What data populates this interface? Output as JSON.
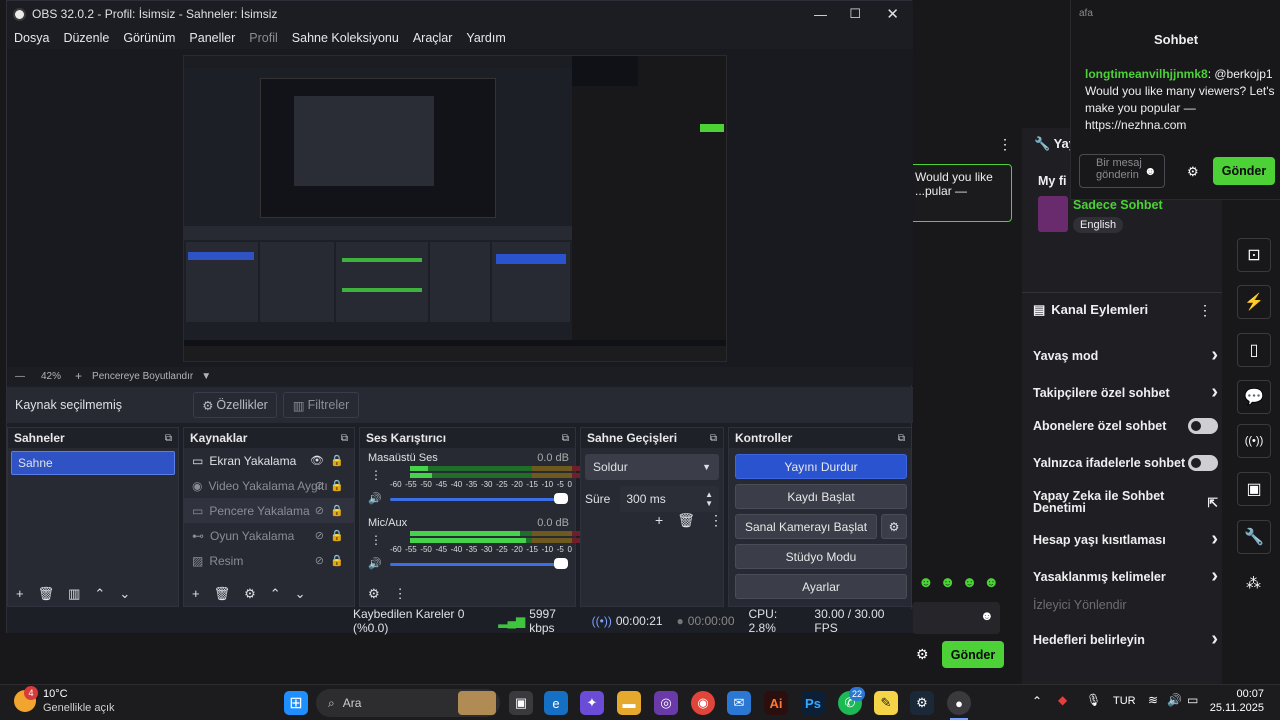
{
  "window": {
    "title": "OBS 32.0.2 - Profil: İsimsiz - Sahneler: İsimsiz",
    "menu": [
      "Dosya",
      "Düzenle",
      "Görünüm",
      "Paneller",
      "Profil",
      "Sahne Koleksiyonu",
      "Araçlar",
      "Yardım"
    ]
  },
  "preview": {
    "zoom": "42%",
    "fit_label": "Pencereye Boyutlandır"
  },
  "source_bar": {
    "status": "Kaynak seçilmemiş",
    "properties": "Özellikler",
    "filters": "Filtreler"
  },
  "scenes": {
    "header": "Sahneler",
    "items": [
      "Sahne"
    ]
  },
  "sources": {
    "header": "Kaynaklar",
    "items": [
      {
        "name": "Ekran Yakalama",
        "visible": true
      },
      {
        "name": "Video Yakalama Aygıtı",
        "visible": false
      },
      {
        "name": "Pencere Yakalama",
        "visible": false
      },
      {
        "name": "Oyun Yakalama",
        "visible": false
      },
      {
        "name": "Resim",
        "visible": false
      }
    ]
  },
  "mixer": {
    "header": "Ses Karıştırıcı",
    "channels": [
      {
        "name": "Masaüstü Ses",
        "db": "0.0 dB"
      },
      {
        "name": "Mic/Aux",
        "db": "0.0 dB"
      }
    ],
    "scale": [
      "-60",
      "-55",
      "-50",
      "-45",
      "-40",
      "-35",
      "-30",
      "-25",
      "-20",
      "-15",
      "-10",
      "-5",
      "0"
    ]
  },
  "transitions": {
    "header": "Sahne Geçişleri",
    "selected": "Soldur",
    "duration_label": "Süre",
    "duration": "300 ms"
  },
  "controls": {
    "header": "Kontroller",
    "buttons": [
      "Yayını Durdur",
      "Kaydı Başlat",
      "Sanal Kamerayı Başlat",
      "Stüdyo Modu",
      "Ayarlar"
    ]
  },
  "status": {
    "dropped": "Kaybedilen Kareler 0 (%0.0)",
    "bitrate": "5997 kbps",
    "stream_time": "00:00:21",
    "rec_time": "00:00:00",
    "cpu": "CPU: 2.8%",
    "fps": "30.00 / 30.00 FPS"
  },
  "chat_popup": {
    "top_label": "afa",
    "title": "Sohbet",
    "username": "longtimeanvilhjjnmk8",
    "message": ": @berkojp1 Would you like many viewers? Let's make you popular — https://nezhna.com",
    "input_placeholder": "Bir mesaj gönderin",
    "send": "Gönder"
  },
  "background_page": {
    "chat_snippet": "Would you like ...pular —",
    "left_heading": "Yay",
    "my_label": "My fi",
    "channel_mode": "Sadece Sohbet",
    "language": "English",
    "kanal_title": "Kanal Eylemleri",
    "kanal_items": [
      {
        "label": "Yavaş mod",
        "kind": "arrow"
      },
      {
        "label": "Takipçilere özel sohbet",
        "kind": "arrow"
      },
      {
        "label": "Abonelere özel sohbet",
        "kind": "toggle"
      },
      {
        "label": "Yalnızca ifadelerle sohbet",
        "kind": "toggle"
      },
      {
        "label": "Yapay Zeka ile Sohbet Denetimi",
        "kind": "ext"
      },
      {
        "label": "Hesap yaşı kısıtlaması",
        "kind": "arrow"
      },
      {
        "label": "Yasaklanmış kelimeler",
        "kind": "arrow"
      },
      {
        "label": "İzleyici Yönlendir",
        "kind": "none"
      },
      {
        "label": "Hedefleri belirleyin",
        "kind": "arrow"
      }
    ],
    "send": "Gönder"
  },
  "taskbar": {
    "weather_temp": "10°C",
    "weather_desc": "Genellikle açık",
    "weather_badge": "4",
    "search": "Ara",
    "whatsapp_badge": "22",
    "lang": "TUR",
    "time": "00:07",
    "date": "25.11.2025"
  },
  "colors": {
    "accent_green": "#4cd137",
    "scene_selected": "#2f52c4",
    "stop_stream": "#2a53cf"
  }
}
